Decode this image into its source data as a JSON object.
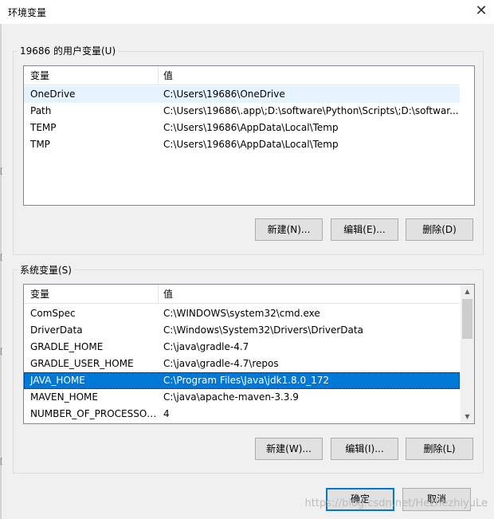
{
  "window": {
    "title": "环境变量",
    "close_glyph": "✕"
  },
  "user_vars": {
    "group_label": "19686 的用户变量(U)",
    "columns": [
      "变量",
      "值"
    ],
    "rows": [
      {
        "name": "OneDrive",
        "value": "C:\\Users\\19686\\OneDrive"
      },
      {
        "name": "Path",
        "value": "C:\\Users\\19686\\.app\\;D:\\software\\Python\\Scripts\\;D:\\softwar..."
      },
      {
        "name": "TEMP",
        "value": "C:\\Users\\19686\\AppData\\Local\\Temp"
      },
      {
        "name": "TMP",
        "value": "C:\\Users\\19686\\AppData\\Local\\Temp"
      }
    ],
    "buttons": {
      "new": "新建(N)...",
      "edit": "编辑(E)...",
      "delete": "删除(D)"
    }
  },
  "system_vars": {
    "group_label": "系统变量(S)",
    "columns": [
      "变量",
      "值"
    ],
    "rows": [
      {
        "name": "ComSpec",
        "value": "C:\\WINDOWS\\system32\\cmd.exe"
      },
      {
        "name": "DriverData",
        "value": "C:\\Windows\\System32\\Drivers\\DriverData"
      },
      {
        "name": "GRADLE_HOME",
        "value": "C:\\java\\gradle-4.7"
      },
      {
        "name": "GRADLE_USER_HOME",
        "value": "C:\\java\\gradle-4.7\\repos"
      },
      {
        "name": "JAVA_HOME",
        "value": "C:\\Program Files\\Java\\jdk1.8.0_172"
      },
      {
        "name": "MAVEN_HOME",
        "value": "C:\\java\\apache-maven-3.3.9"
      },
      {
        "name": "NUMBER_OF_PROCESSORS",
        "value": "4"
      }
    ],
    "buttons": {
      "new": "新建(W)...",
      "edit": "编辑(I)...",
      "delete": "删除(L)"
    }
  },
  "footer": {
    "ok": "确定",
    "cancel": "取消"
  },
  "watermark": "https://blog.csdn.net/HezhezhiyuLe",
  "colors": {
    "selection": "#0078d7",
    "hover": "#e5f3ff",
    "default_button_border": "#0078d7"
  }
}
